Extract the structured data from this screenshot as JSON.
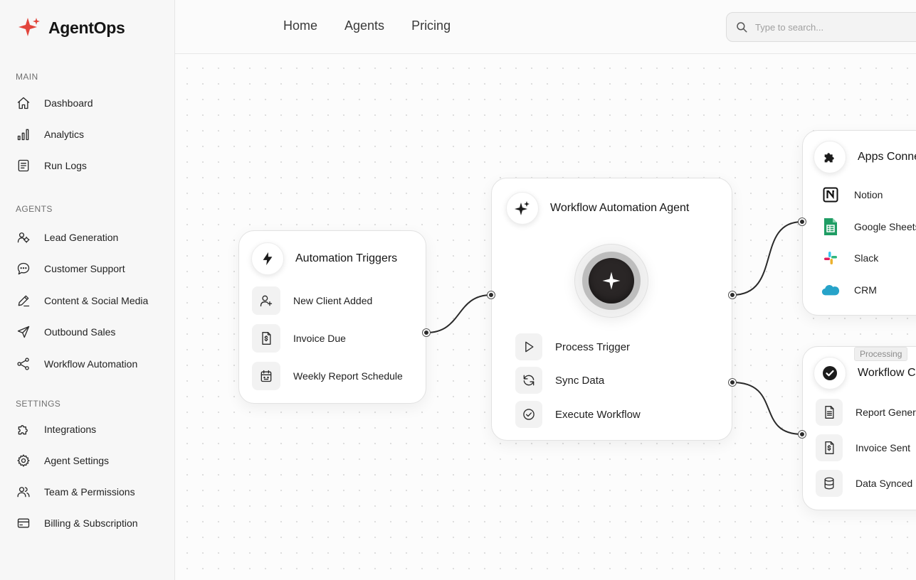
{
  "brand": {
    "name": "AgentOps",
    "accent": "#e2453c"
  },
  "sidebar": {
    "sections": {
      "main": "MAIN",
      "agents": "AGENTS",
      "settings": "SETTINGS"
    },
    "main_items": [
      {
        "label": "Dashboard",
        "icon": "home-icon"
      },
      {
        "label": "Analytics",
        "icon": "bar-chart-icon"
      },
      {
        "label": "Run Logs",
        "icon": "log-icon"
      }
    ],
    "agent_items": [
      {
        "label": "Lead Generation",
        "icon": "users-gear-icon"
      },
      {
        "label": "Customer Support",
        "icon": "chat-icon"
      },
      {
        "label": "Content & Social Media",
        "icon": "pen-icon"
      },
      {
        "label": "Outbound Sales",
        "icon": "send-icon"
      },
      {
        "label": "Workflow Automation",
        "icon": "share-nodes-icon"
      }
    ],
    "settings_items": [
      {
        "label": "Integrations",
        "icon": "puzzle-icon"
      },
      {
        "label": "Agent Settings",
        "icon": "gear-icon"
      },
      {
        "label": "Team & Permissions",
        "icon": "team-icon"
      },
      {
        "label": "Billing & Subscription",
        "icon": "credit-card-icon"
      }
    ]
  },
  "topnav": {
    "links": [
      "Home",
      "Agents",
      "Pricing"
    ],
    "search_placeholder": "Type to search..."
  },
  "triggers": {
    "title": "Automation Triggers",
    "items": [
      {
        "label": "New Client Added",
        "icon": "user-plus-icon"
      },
      {
        "label": "Invoice Due",
        "icon": "invoice-icon"
      },
      {
        "label": "Weekly Report Schedule",
        "icon": "calendar-icon"
      }
    ]
  },
  "agent": {
    "title": "Workflow Automation Agent",
    "steps": [
      {
        "label": "Process Trigger",
        "icon": "play-icon"
      },
      {
        "label": "Sync Data",
        "icon": "refresh-icon"
      },
      {
        "label": "Execute Workflow",
        "icon": "check-circle-icon"
      }
    ]
  },
  "apps": {
    "title": "Apps Connec",
    "items": [
      {
        "label": "Notion",
        "icon": "notion-icon"
      },
      {
        "label": "Google Sheets",
        "icon": "google-sheets-icon"
      },
      {
        "label": "Slack",
        "icon": "slack-icon"
      },
      {
        "label": "CRM",
        "icon": "salesforce-cloud-icon"
      }
    ]
  },
  "outputs": {
    "badge": "Processing",
    "title": "Workflow Co",
    "items": [
      {
        "label": "Report Genera",
        "icon": "document-icon"
      },
      {
        "label": "Invoice Sent",
        "icon": "invoice-icon"
      },
      {
        "label": "Data Synced",
        "icon": "database-icon"
      }
    ]
  }
}
